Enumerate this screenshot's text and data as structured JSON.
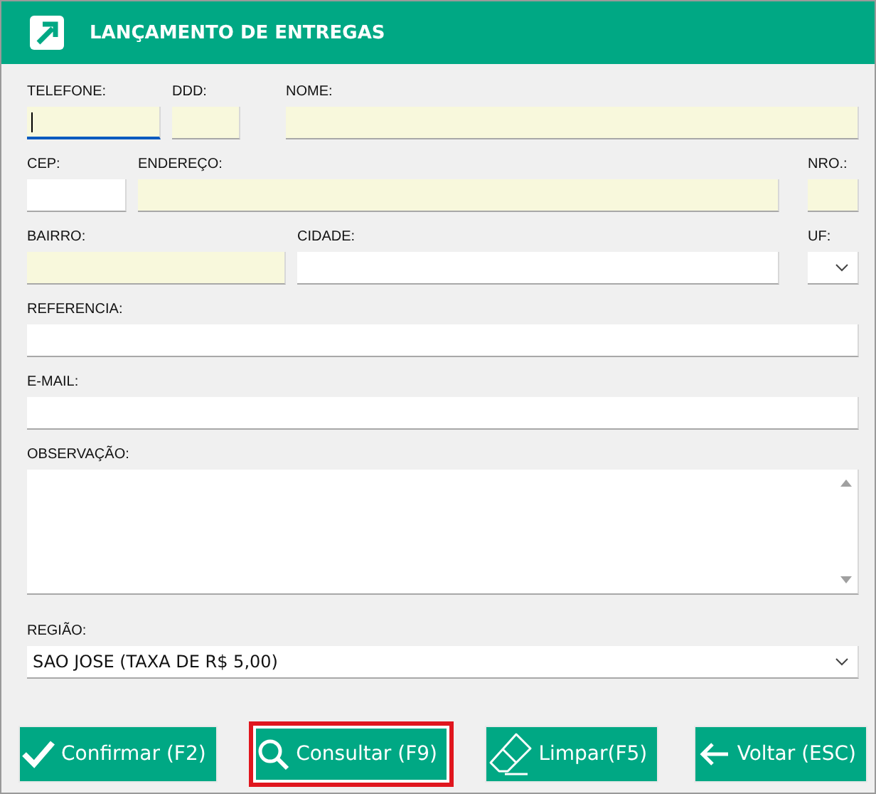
{
  "window": {
    "title": "LANÇAMENTO DE ENTREGAS"
  },
  "rows": [
    {
      "fields": [
        {
          "label": "TELEFONE:",
          "kind": "text",
          "required": true,
          "focused": true
        },
        {
          "label": "DDD:",
          "kind": "text",
          "required": true,
          "focused": false
        },
        {
          "label": "NOME:",
          "kind": "text",
          "required": true,
          "focused": false
        }
      ]
    },
    {
      "fields": [
        {
          "label": "CEP:",
          "kind": "text",
          "required": false,
          "focused": false
        },
        {
          "label": "ENDEREÇO:",
          "kind": "text",
          "required": true,
          "focused": false
        },
        {
          "label": "NRO.:",
          "kind": "text",
          "required": true,
          "focused": false
        }
      ]
    },
    {
      "fields": [
        {
          "label": "BAIRRO:",
          "kind": "text",
          "required": true,
          "focused": false
        },
        {
          "label": "CIDADE:",
          "kind": "text",
          "required": false,
          "focused": false
        },
        {
          "label": "UF:",
          "kind": "select",
          "required": false,
          "focused": false
        }
      ]
    },
    {
      "fields": [
        {
          "label": "REFERENCIA:",
          "kind": "text",
          "required": false,
          "focused": false
        }
      ]
    },
    {
      "fields": [
        {
          "label": "E-MAIL:",
          "kind": "text",
          "required": false,
          "focused": false
        }
      ]
    },
    {
      "fields": [
        {
          "label": "OBSERVAÇÃO:",
          "kind": "textarea",
          "required": false,
          "focused": false
        }
      ]
    },
    {
      "fields": [
        {
          "label": "REGIÃO:",
          "kind": "select",
          "required": false,
          "focused": false,
          "value": "SAO JOSE (TAXA DE R$ 5,00)"
        }
      ]
    }
  ],
  "buttons": [
    {
      "label": "Confirmar (F2)",
      "kind": "confirm",
      "selected": false
    },
    {
      "label": "Consultar (F9)",
      "kind": "search",
      "selected": true
    },
    {
      "label": "Limpar(F5)",
      "kind": "clear",
      "selected": false
    },
    {
      "label": "Voltar (ESC)",
      "kind": "back",
      "selected": false
    }
  ]
}
